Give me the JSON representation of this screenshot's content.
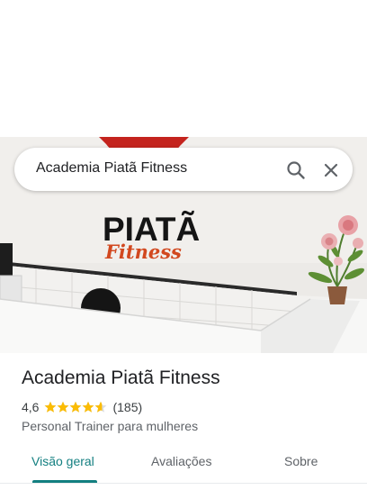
{
  "search": {
    "value": "Academia Piatã Fitness"
  },
  "place": {
    "name": "Academia Piatã Fitness",
    "rating": "4,6",
    "rating_stars": 4.6,
    "review_count": "(185)",
    "category": "Personal Trainer para mulheres"
  },
  "hero": {
    "logo_line1": "PIATÃ",
    "logo_line2": "Fitness"
  },
  "tabs": [
    {
      "label": "Visão geral",
      "active": true
    },
    {
      "label": "Avaliações",
      "active": false
    },
    {
      "label": "Sobre",
      "active": false
    }
  ],
  "colors": {
    "accent": "#137f80",
    "star": "#fbbc04",
    "logo_red": "#c4241e"
  },
  "icons": {
    "search": "search-icon",
    "close": "close-icon"
  }
}
